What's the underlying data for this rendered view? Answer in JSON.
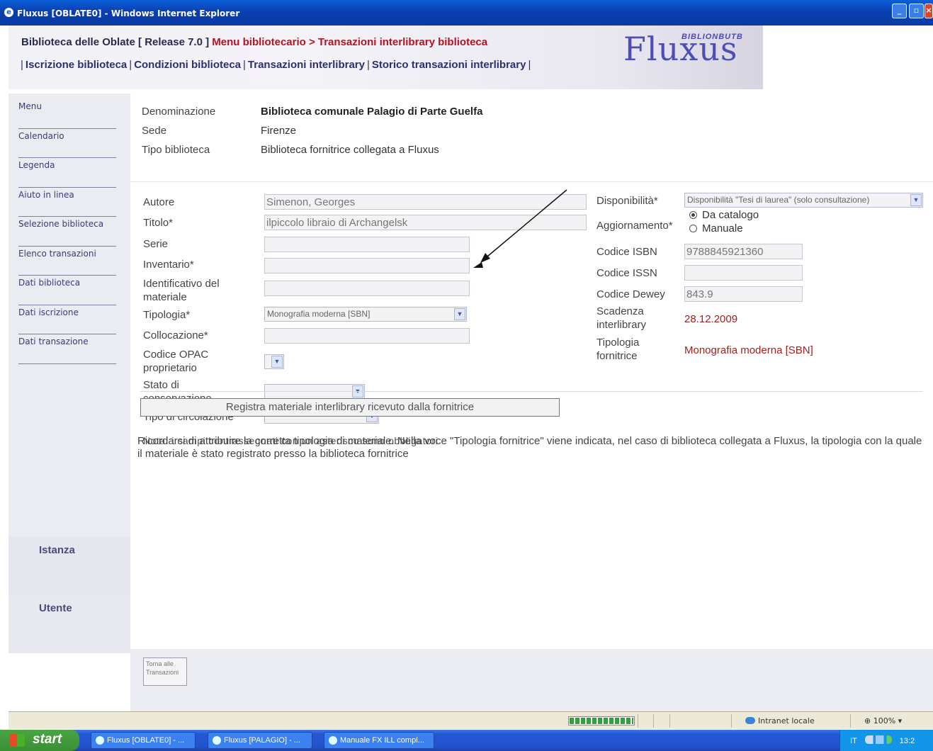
{
  "window": {
    "title": "Fluxus [OBLATE0] - Windows Internet Explorer",
    "controls": [
      "minimize",
      "maximize",
      "close"
    ]
  },
  "header": {
    "breadcrumb_main": "Biblioteca delle Oblate [ Release 7.0 ]",
    "breadcrumb_path": "Menu bibliotecario > Transazioni interlibrary biblioteca",
    "nav": [
      "Iscrizione biblioteca",
      "Condizioni biblioteca",
      "Transazioni interlibrary",
      "Storico transazioni interlibrary"
    ],
    "nav_sep": "|",
    "logo_sub": "BIBLIONBUTB",
    "logo_main": "Fluxus"
  },
  "sidebar": {
    "items": [
      "Menu",
      "Calendario",
      "Legenda",
      "Aiuto in linea",
      "Selezione biblioteca",
      "Elenco transazioni",
      "Dati biblioteca",
      "Dati iscrizione",
      "Dati transazione"
    ],
    "istanza": "Istanza",
    "utente": "Utente"
  },
  "library": {
    "denominazione_label": "Denominazione",
    "denominazione": "Biblioteca comunale Palagio di Parte Guelfa",
    "sede_label": "Sede",
    "sede": "Firenze",
    "tipo_label": "Tipo biblioteca",
    "tipo": "Biblioteca fornitrice collegata a Fluxus"
  },
  "form": {
    "autore_label": "Autore",
    "autore": "Simenon, Georges",
    "titolo_label": "Titolo*",
    "titolo": "ilpiccolo libraio di Archangelsk",
    "serie_label": "Serie",
    "serie": "",
    "inventario_label": "Inventario*",
    "inventario": "",
    "identificativo_label": "Identificativo del materiale",
    "identificativo": "",
    "tipologia_label": "Tipologia*",
    "tipologia": "Monografia moderna [SBN]",
    "collocazione_label": "Collocazione*",
    "collocazione": "",
    "opac_label": "Codice OPAC proprietario",
    "opac": "",
    "stato_label": "Stato di conservazione",
    "stato": "",
    "circolazione_label": "Tipo di circolazione",
    "circolazione": "",
    "disponibilita_label": "Disponibilità*",
    "disponibilita": "Disponibilità \"Tesi di laurea\" (solo consultazione)",
    "aggiornamento_label": "Aggiornamento*",
    "aggiornamento_options": [
      "Da catalogo",
      "Manuale"
    ],
    "aggiornamento_selected": "Da catalogo",
    "isbn_label": "Codice ISBN",
    "isbn": "9788845921360",
    "issn_label": "Codice ISSN",
    "issn": "",
    "dewey_label": "Codice Dewey",
    "dewey": "843.9",
    "scadenza_label": "Scadenza interlibrary",
    "scadenza": "28.12.2009",
    "tipologia_fornitrice_label": "Tipologia fornitrice",
    "tipologia_fornitrice": "Monografia moderna [SBN]",
    "note": "Nota: i campi contrassegnati con un asterisco sono obbligatori",
    "submit_label": "Registra materiale interlibrary ricevuto dalla fornitrice",
    "footnote": "Ricordarsi di attribuire la corretta tipologia di materiale. Nella voce \"Tipologia fornitrice\" viene indicata, nel caso di biblioteca collegata a Fluxus, la tipologia con la quale il materiale è stato registrato presso la biblioteca fornitrice"
  },
  "footer": {
    "back_label": "Torna alle Transazioni"
  },
  "statusbar": {
    "zone": "Intranet locale",
    "zoom": "100%"
  },
  "taskbar": {
    "start": "start",
    "tasks": [
      "Fluxus [OBLATE0] - ...",
      "Fluxus [PALAGIO] - ...",
      "Manuale FX ILL compl..."
    ],
    "lang": "IT",
    "time": "13:2"
  }
}
